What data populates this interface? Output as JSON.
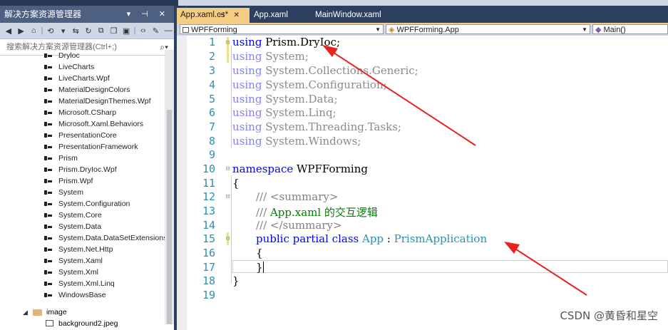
{
  "solution_explorer": {
    "title": "解决方案资源管理器",
    "title_controls": "▾ ⊣ ✕",
    "search_placeholder": "搜索解决方案资源管理器(Ctrl+;)",
    "references": [
      "Dryloc",
      "LiveCharts",
      "LiveCharts.Wpf",
      "MaterialDesignColors",
      "MaterialDesignThemes.Wpf",
      "Microsoft.CSharp",
      "Microsoft.Xaml.Behaviors",
      "PresentationCore",
      "PresentationFramework",
      "Prism",
      "Prism.DryIoc.Wpf",
      "Prism.Wpf",
      "System",
      "System.Configuration",
      "System.Core",
      "System.Data",
      "System.Data.DataSetExtensions",
      "System.Net.Http",
      "System.Xaml",
      "System.Xml",
      "System.Xml.Linq",
      "WindowsBase"
    ],
    "folder": "image",
    "file": "background2.jpeg"
  },
  "tabs": {
    "active": "App.xaml.cs*",
    "active_controls": "⊣ ✕",
    "tab2": "App.xaml",
    "tab3": "MainWindow.xaml"
  },
  "navbar": {
    "project": "WPFForming",
    "class": "WPFForming.App",
    "member": "Main()"
  },
  "code": {
    "line_numbers": [
      "1",
      "2",
      "3",
      "4",
      "5",
      "6",
      "7",
      "8",
      "9",
      "10",
      "11",
      "12",
      "13",
      "14",
      "15",
      "16",
      "17",
      "18",
      "19"
    ],
    "using_kw": "using",
    "l1": " Prism.DryIoc;",
    "l2": " System;",
    "l3": " System.Collections.Generic;",
    "l4": " System.Configuration;",
    "l5": " System.Data;",
    "l6": " System.Linq;",
    "l7": " System.Threading.Tasks;",
    "l8": " System.Windows;",
    "ns_kw": "namespace",
    "ns_name": " WPFForming",
    "open_brace": "{",
    "close_brace": "}",
    "cm1": "/// <summary>",
    "cm2_prefix": "/// ",
    "cm2_text": "App.xaml 的交互逻辑",
    "cm3": "/// </summary>",
    "decl_kw": "public partial class",
    "decl_name": "App",
    "decl_colon": " : ",
    "decl_base": "PrismApplication"
  },
  "watermark": "CSDN @黄昏和星空",
  "colors": {
    "arrow": "#e8231d",
    "active_tab": "#f5cc84",
    "keyword": "#0000ff",
    "type": "#2b91af",
    "comment": "#008000"
  }
}
